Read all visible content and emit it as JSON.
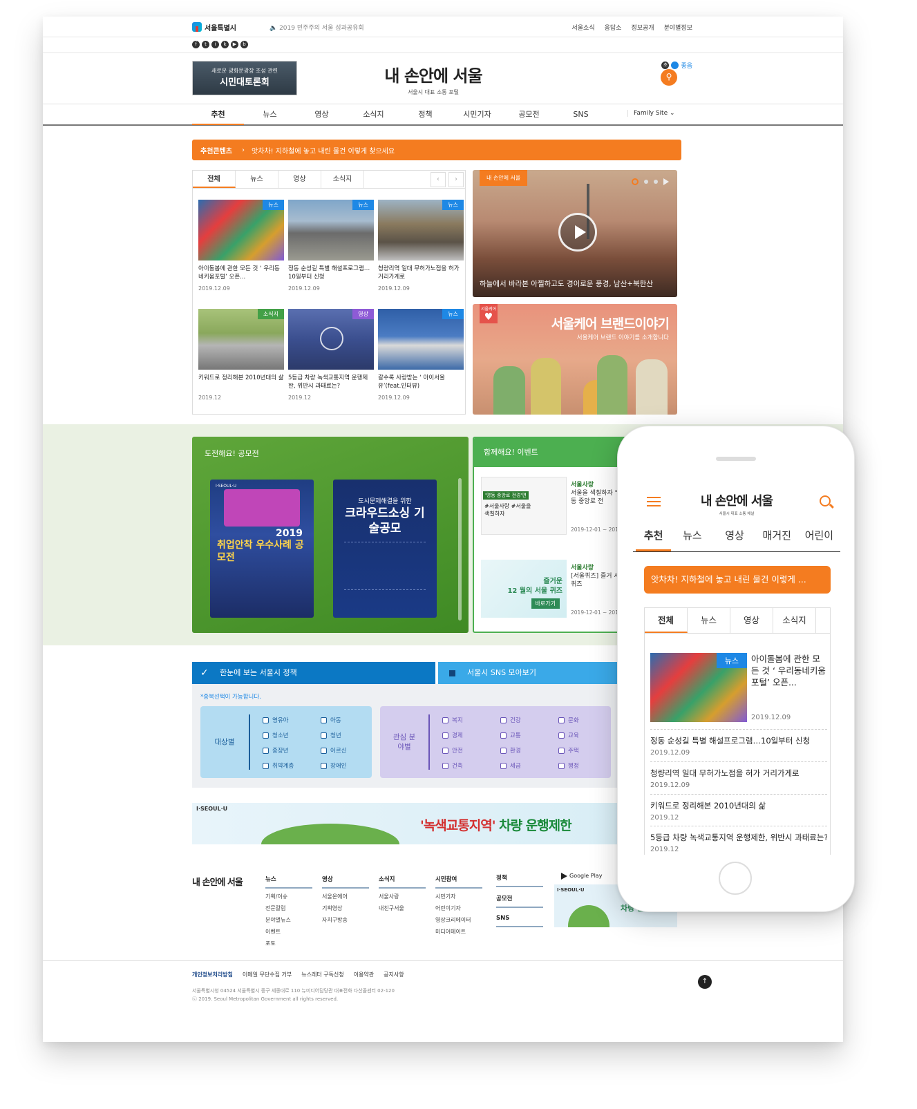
{
  "header": {
    "logo": "서울특별시",
    "notice": "2019 민주주의 서울 성과공유회",
    "links": [
      "서울소식",
      "응답소",
      "정보공개",
      "분야별정보"
    ],
    "dust_label": "초미세먼지",
    "dust_value": "좋음",
    "banner_top": "새로운 광화문광장 조성 관련",
    "banner_main": "시민대토론회",
    "site_title": "내 손안에 서울",
    "site_sub": "서울시 대표 소통 포털"
  },
  "nav": {
    "items": [
      "추천",
      "뉴스",
      "영상",
      "소식지",
      "정책",
      "시민기자",
      "공모전",
      "SNS"
    ],
    "active": "추천",
    "family": "Family Site"
  },
  "recommend": {
    "label": "추천콘텐츠",
    "text": "앗차차! 지하철에 놓고 내린 물건 이렇게 찾으세요"
  },
  "tabs": [
    "전체",
    "뉴스",
    "영상",
    "소식지"
  ],
  "cards": [
    {
      "tag": "뉴스",
      "title": "아이돌봄에 관한 모든 것 ‘ 우리동네키움포털’ 오픈...",
      "date": "2019.12.09"
    },
    {
      "tag": "뉴스",
      "title": "정동 순성길 특별 해설프로그램…10일부터 신청",
      "date": "2019.12.09"
    },
    {
      "tag": "뉴스",
      "title": "청량리역 일대 무허가노점을 허가 거리가게로",
      "date": "2019.12.09"
    },
    {
      "tag": "소식지",
      "title": "키워드로 정리해본 2010년대의 삶",
      "date": "2019.12"
    },
    {
      "tag": "영상",
      "title": "5등급 차량 녹색교통지역 운행제한, 위반시 과태료는?",
      "date": "2019.12"
    },
    {
      "tag": "뉴스",
      "title": "갈수록 사랑받는 ‘ 아이서울유’(feat.인터뷰)",
      "date": "2019.12.09"
    }
  ],
  "video": {
    "label": "내 손안에 서울",
    "caption": "하늘에서 바라본 아찔하고도 경이로운 풍경, 남산+북한산"
  },
  "brand": {
    "badge": "서울케어",
    "title": "서울케어 브랜드이야기",
    "sub": "서울케어 브랜드 이야기를 소개합니다"
  },
  "contest": {
    "title": "도전해요! 공모전",
    "poster1_brand": "I·SEOUL·U",
    "poster1_year": "2019",
    "poster1_title": "취업안착 우수사례 공모전",
    "poster2_sub": "도시문제해결을 위한",
    "poster2_title": "크라우드소싱 기술공모"
  },
  "events": {
    "title": "함께해요! 이벤트",
    "items": [
      {
        "source": "서울사랑",
        "title": "서울을 색칠하자 \"명동 중앙로 전",
        "date": "2019-12-01 ~ 2019",
        "tag": "'명동 중앙로 전경'편",
        "img_text": "#서울사랑 #서울을 색칠하자"
      },
      {
        "source": "서울사랑",
        "title": "[서울퀴즈] 즐거 서울 퀴즈",
        "date": "2019-12-01 ~ 2019",
        "img_text": "12 월의 서울 퀴즈",
        "img_btn": "바로가기",
        "img_fun": "즐거운"
      }
    ]
  },
  "policy": {
    "tab1": "한눈에 보는 서울시 정책",
    "tab2": "서울시 SNS 모아보기",
    "note": "*중복선택이 가능합니다.",
    "target_label": "대상별",
    "target_items": [
      "영유아",
      "아동",
      "청소년",
      "청년",
      "중장년",
      "어르신",
      "취약계층",
      "장애인"
    ],
    "field_label": "관심 분야별",
    "field_items": [
      "복지",
      "건강",
      "문화",
      "경제",
      "교통",
      "교육",
      "안전",
      "환경",
      "주택",
      "건축",
      "세금",
      "행정"
    ]
  },
  "ad": {
    "brand": "I·SEOUL·U",
    "text_highlight": "'녹색교통지역'",
    "text_rest": " 차량 운행제한"
  },
  "footer": {
    "title": "내 손안에 서울",
    "cols": [
      {
        "h": "뉴스",
        "l": [
          "기획/이슈",
          "전문칼럼",
          "분야별뉴스",
          "이벤트",
          "포토"
        ]
      },
      {
        "h": "영상",
        "l": [
          "서울온에어",
          "기획영상",
          "자치구방송"
        ]
      },
      {
        "h": "소식지",
        "l": [
          "서울사랑",
          "내친구서울"
        ]
      },
      {
        "h": "시민참여",
        "l": [
          "시민기자",
          "어린이기자",
          "영상크리에이터",
          "미디어메이트"
        ]
      }
    ],
    "policy_col": [
      "정책",
      "공모전",
      "SNS"
    ],
    "gplay": "Google Play",
    "fad_brand": "I·SEOUL·U",
    "fad_text1": "'녹색",
    "fad_text2": "차량 운행제한",
    "bottom_links": [
      "개인정보처리방침",
      "이메일 무단수집 거부",
      "뉴스레터 구독신청",
      "이용약관",
      "공지사항"
    ],
    "address": "서울특별시청 04524 서울특별시 중구 세종대로 110    뉴미디어담당관    대표전화 다산콜센터 02-120",
    "copyright": "ⓒ 2019. Seoul Metropolitan Government all rights reserved."
  },
  "mobile": {
    "title": "내 손안에 서울",
    "sub": "서울시 대표 소통 채널",
    "nav": [
      "추천",
      "뉴스",
      "영상",
      "매거진",
      "어린이"
    ],
    "rec": "앗차차! 지하철에 놓고 내린 물건 이렇게 ...",
    "tabs": [
      "전체",
      "뉴스",
      "영상",
      "소식지"
    ],
    "feature": {
      "tag": "뉴스",
      "title": "아이돌봄에 관한 모든 것 ‘ 우리동네키움포털’ 오픈...",
      "date": "2019.12.09"
    },
    "items": [
      {
        "t": "정동 순성길 특별 해설프로그램…10일부터 신청",
        "d": "2019.12.09"
      },
      {
        "t": "청량리역 일대 무허가노점을 허가 거리가게로",
        "d": "2019.12.09"
      },
      {
        "t": "키워드로 정리해본 2010년대의 삶",
        "d": "2019.12"
      },
      {
        "t": "5등급 차량 녹색교통지역 운행제한, 위반시 과태료는?",
        "d": "2019.12"
      }
    ]
  },
  "colors": {
    "accent": "#f47c20",
    "green": "#4caf50",
    "blue": "#0b78c4"
  }
}
